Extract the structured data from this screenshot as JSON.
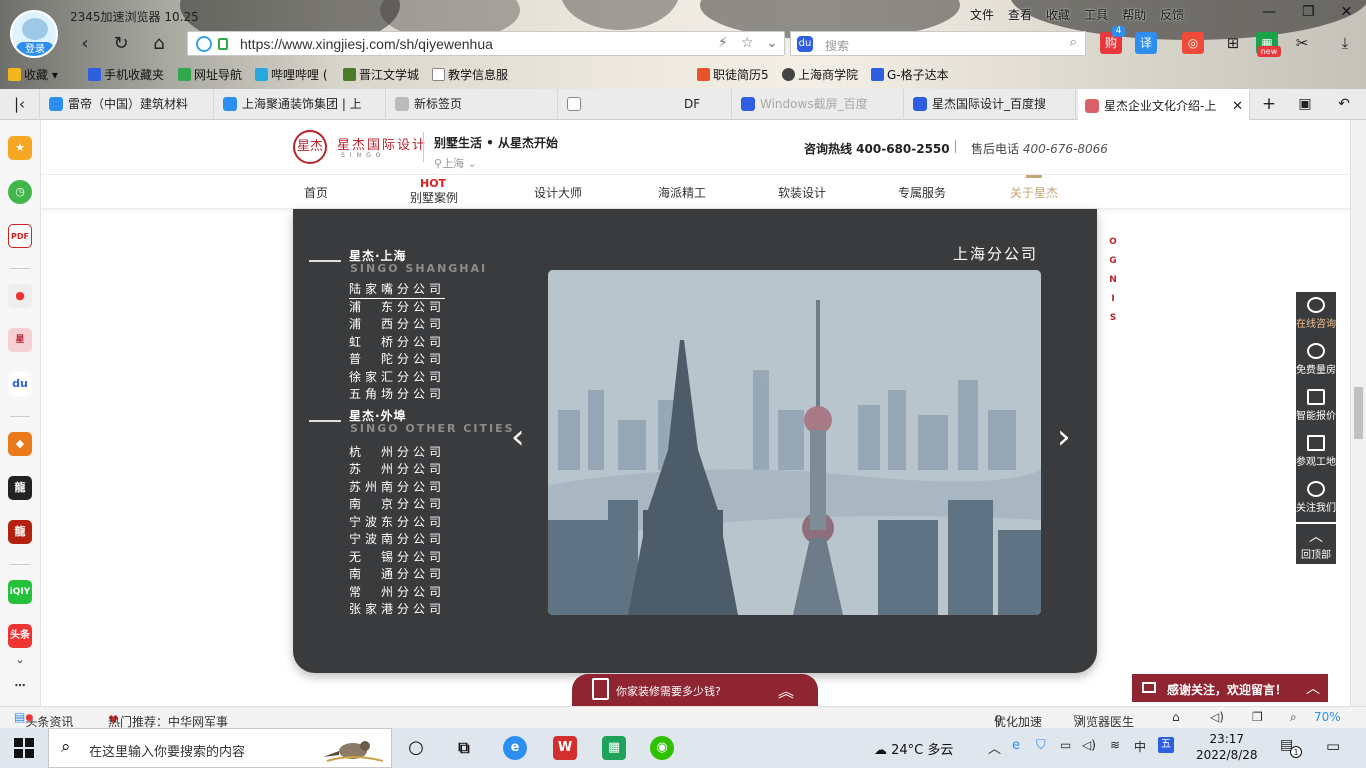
{
  "browser": {
    "title": "2345加速浏览器 10.25",
    "login_label": "登录",
    "menu": [
      "文件",
      "查看",
      "收藏",
      "工具",
      "帮助",
      "反馈"
    ],
    "url": "https://www.xingjiesj.com/sh/qiyewenhua",
    "search_placeholder": "搜索",
    "ext_badge": "4",
    "ext_new": "new",
    "favorites": [
      "收藏",
      "手机收藏夹",
      "网址导航",
      "哔哩哔哩 (",
      "晋江文学城",
      "教学信息服",
      "职徒简历5",
      "上海商学院",
      "G-格子达本"
    ],
    "tabs": [
      "雷帝（中国）建筑材料",
      "上海聚通装饰集团 | 上",
      "新标签页",
      "DF",
      "Windows截屏_百度",
      "星杰国际设计_百度搜",
      "星杰企业文化介绍-上"
    ]
  },
  "site": {
    "logo_seal": "星杰",
    "logo_cn": "星杰国际设计",
    "logo_en": "SINGO",
    "slogan": "别墅生活 • 从星杰开始",
    "city": "上海",
    "hotline": "咨询热线 400-680-2550",
    "service_label": "售后电话",
    "service_phone": "400-676-8066",
    "hot": "HOT",
    "nav": [
      "首页",
      "别墅案例",
      "设计大师",
      "海派精工",
      "软装设计",
      "专属服务",
      "关于星杰"
    ],
    "active_nav": "关于星杰"
  },
  "panel": {
    "title": "上海分公司",
    "groups": [
      {
        "cn": "星杰·上海",
        "en": "SINGO SHANGHAI",
        "branches": [
          "陆家嘴分公司",
          "浦　东分公司",
          "浦　西分公司",
          "虹　桥分公司",
          "普　陀分公司",
          "徐家汇分公司",
          "五角场分公司"
        ]
      },
      {
        "cn": "星杰·外埠",
        "en": "SINGO OTHER CITIES",
        "branches": [
          "杭　州分公司",
          "苏　州分公司",
          "苏州南分公司",
          "南　京分公司",
          "宁波东分公司",
          "宁波南分公司",
          "无　锡分公司",
          "南　通分公司",
          "常　州分公司",
          "张家港分公司"
        ]
      }
    ],
    "selected_branch": "陆家嘴分公司",
    "vertical_text": "O G N I S"
  },
  "float": [
    "在线咨询",
    "免费量房",
    "智能报价",
    "参观工地",
    "关注我们",
    "回顶部"
  ],
  "banners": {
    "calc": "你家装修需要多少钱?",
    "message": "感谢关注，欢迎留言！"
  },
  "statusbar": {
    "news": "头条资讯",
    "hot": "热门推荐：中华网军事",
    "speed": "优化加速",
    "doctor": "浏览器医生",
    "zoom": "70%"
  },
  "taskbar": {
    "search_placeholder": "在这里输入你要搜索的内容",
    "weather": "24°C  多云",
    "time": "23:17",
    "date": "2022/8/28",
    "notif": "1"
  }
}
